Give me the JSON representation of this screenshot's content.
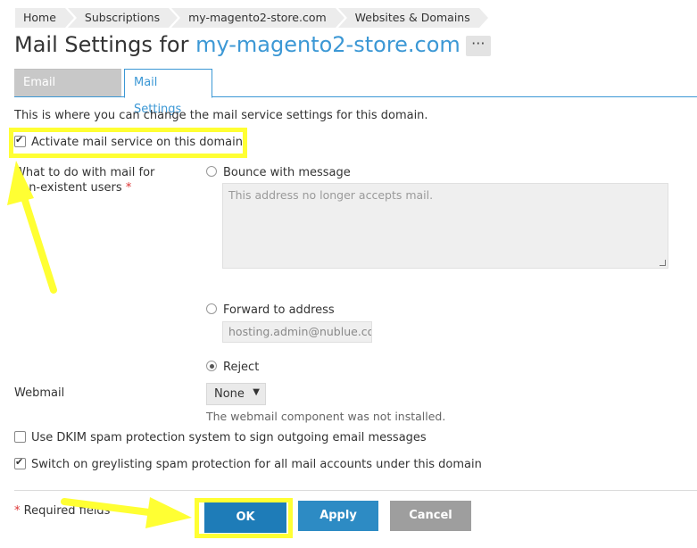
{
  "breadcrumb": [
    "Home",
    "Subscriptions",
    "my-magento2-store.com",
    "Websites & Domains"
  ],
  "title": {
    "prefix": "Mail Settings for ",
    "domain": "my-magento2-store.com",
    "more": "···"
  },
  "tabs": [
    {
      "label": "Email Addresses",
      "active": false
    },
    {
      "label": "Mail Settings",
      "active": true
    }
  ],
  "description": "This is where you can change the mail service settings for this domain.",
  "activate": {
    "label": "Activate mail service on this domain",
    "checked": true
  },
  "nonexistent": {
    "label": "What to do with mail for non-existent users",
    "required_mark": "*",
    "options": [
      {
        "label": "Bounce with message",
        "selected": false
      },
      {
        "label": "Forward to address",
        "selected": false
      },
      {
        "label": "Reject",
        "selected": true
      }
    ],
    "bounce_placeholder": "This address no longer accepts mail.",
    "forward_value": "hosting.admin@nublue.co"
  },
  "webmail": {
    "label": "Webmail",
    "value": "None",
    "hint": "The webmail component was not installed."
  },
  "dkim": {
    "label": "Use DKIM spam protection system to sign outgoing email messages",
    "checked": false
  },
  "greylisting": {
    "label": "Switch on greylisting spam protection for all mail accounts under this domain",
    "checked": true
  },
  "footer": {
    "required_mark": "*",
    "required_text": "Required fields"
  },
  "buttons": {
    "ok": "OK",
    "apply": "Apply",
    "cancel": "Cancel"
  },
  "colors": {
    "accent": "#3c98d5",
    "ok": "#1e7cb8",
    "apply": "#2d8bc4",
    "cancel": "#9e9e9e",
    "annotation": "#ffff33"
  }
}
